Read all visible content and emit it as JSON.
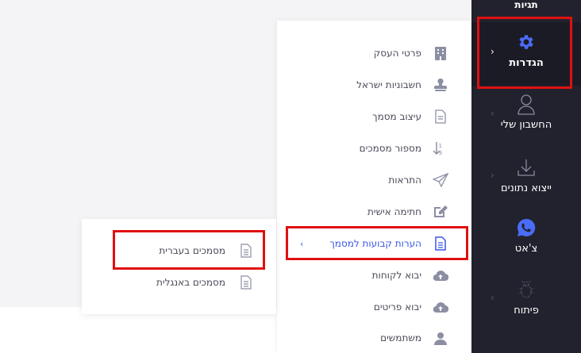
{
  "sidebar": {
    "top_label": "תגיות",
    "items": [
      {
        "label": "הגדרות",
        "icon": "gear-icon",
        "active": true
      },
      {
        "label": "החשבון שלי",
        "icon": "user-icon"
      },
      {
        "label": "ייצוא נתונים",
        "icon": "download-icon"
      },
      {
        "label": "צ'אט",
        "icon": "whatsapp-icon"
      },
      {
        "label": "פיתוח",
        "icon": "bug-icon"
      }
    ]
  },
  "menu": {
    "items": [
      {
        "label": "פרטי העסק",
        "icon": "building-icon"
      },
      {
        "label": "חשבוניות ישראל",
        "icon": "stamp-icon"
      },
      {
        "label": "עיצוב מסמך",
        "icon": "document-icon"
      },
      {
        "label": "מספור מסמכים",
        "icon": "sort-numeric-icon"
      },
      {
        "label": "התראות",
        "icon": "paper-plane-icon"
      },
      {
        "label": "חתימה אישית",
        "icon": "edit-icon"
      },
      {
        "label": "הערות קבועות למסמך",
        "icon": "document-lines-icon",
        "selected": true
      },
      {
        "label": "יבוא לקוחות",
        "icon": "cloud-upload-icon"
      },
      {
        "label": "יבוא פריטים",
        "icon": "cloud-upload-icon"
      },
      {
        "label": "משתמשים",
        "icon": "users-icon"
      }
    ]
  },
  "submenu": {
    "items": [
      {
        "label": "מסמכים בעברית",
        "icon": "document-icon"
      },
      {
        "label": "מסמכים באנגלית",
        "icon": "document-icon"
      }
    ]
  },
  "colors": {
    "sidebar_bg": "#22222e",
    "accent": "#3a57e8",
    "highlight": "#e01010"
  }
}
